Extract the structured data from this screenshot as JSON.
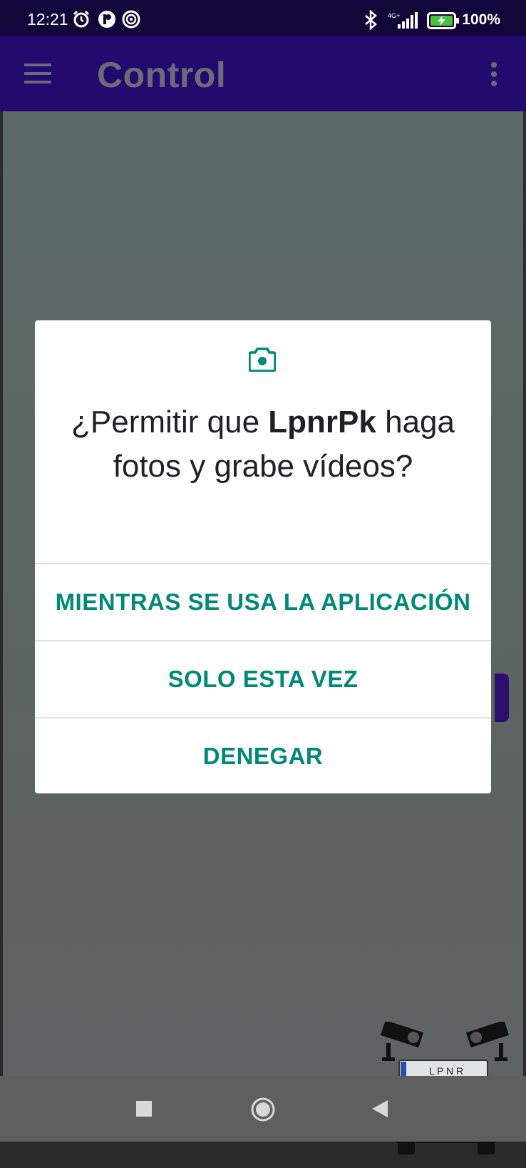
{
  "status_bar": {
    "time": "12:21",
    "network": "4G+",
    "battery": "100%",
    "icons": [
      "alarm-icon",
      "notification-app-icon",
      "hotspot-icon",
      "bluetooth-icon",
      "signal-icon",
      "battery-charging-icon"
    ]
  },
  "app_bar": {
    "title": "Control",
    "icons": [
      "hamburger-menu-icon",
      "overflow-menu-icon"
    ]
  },
  "dialog": {
    "icon": "camera-icon",
    "title_prefix": "¿Permitir que ",
    "app_name": "LpnrPk",
    "title_suffix": " haga fotos y grabe vídeos?",
    "options": [
      "MIENTRAS SE USA LA APLICACIÓN",
      "SOLO ESTA VEZ",
      "DENEGAR"
    ],
    "accent_color": "#00897b"
  },
  "logo": {
    "plate_text": "L P N R"
  },
  "nav_bar": {
    "icons": [
      "recents-square-icon",
      "home-circle-icon",
      "back-triangle-icon"
    ]
  },
  "colors": {
    "status_bar": "#12053a",
    "app_bar": "#230a6e",
    "scrim": "#5d6664"
  }
}
